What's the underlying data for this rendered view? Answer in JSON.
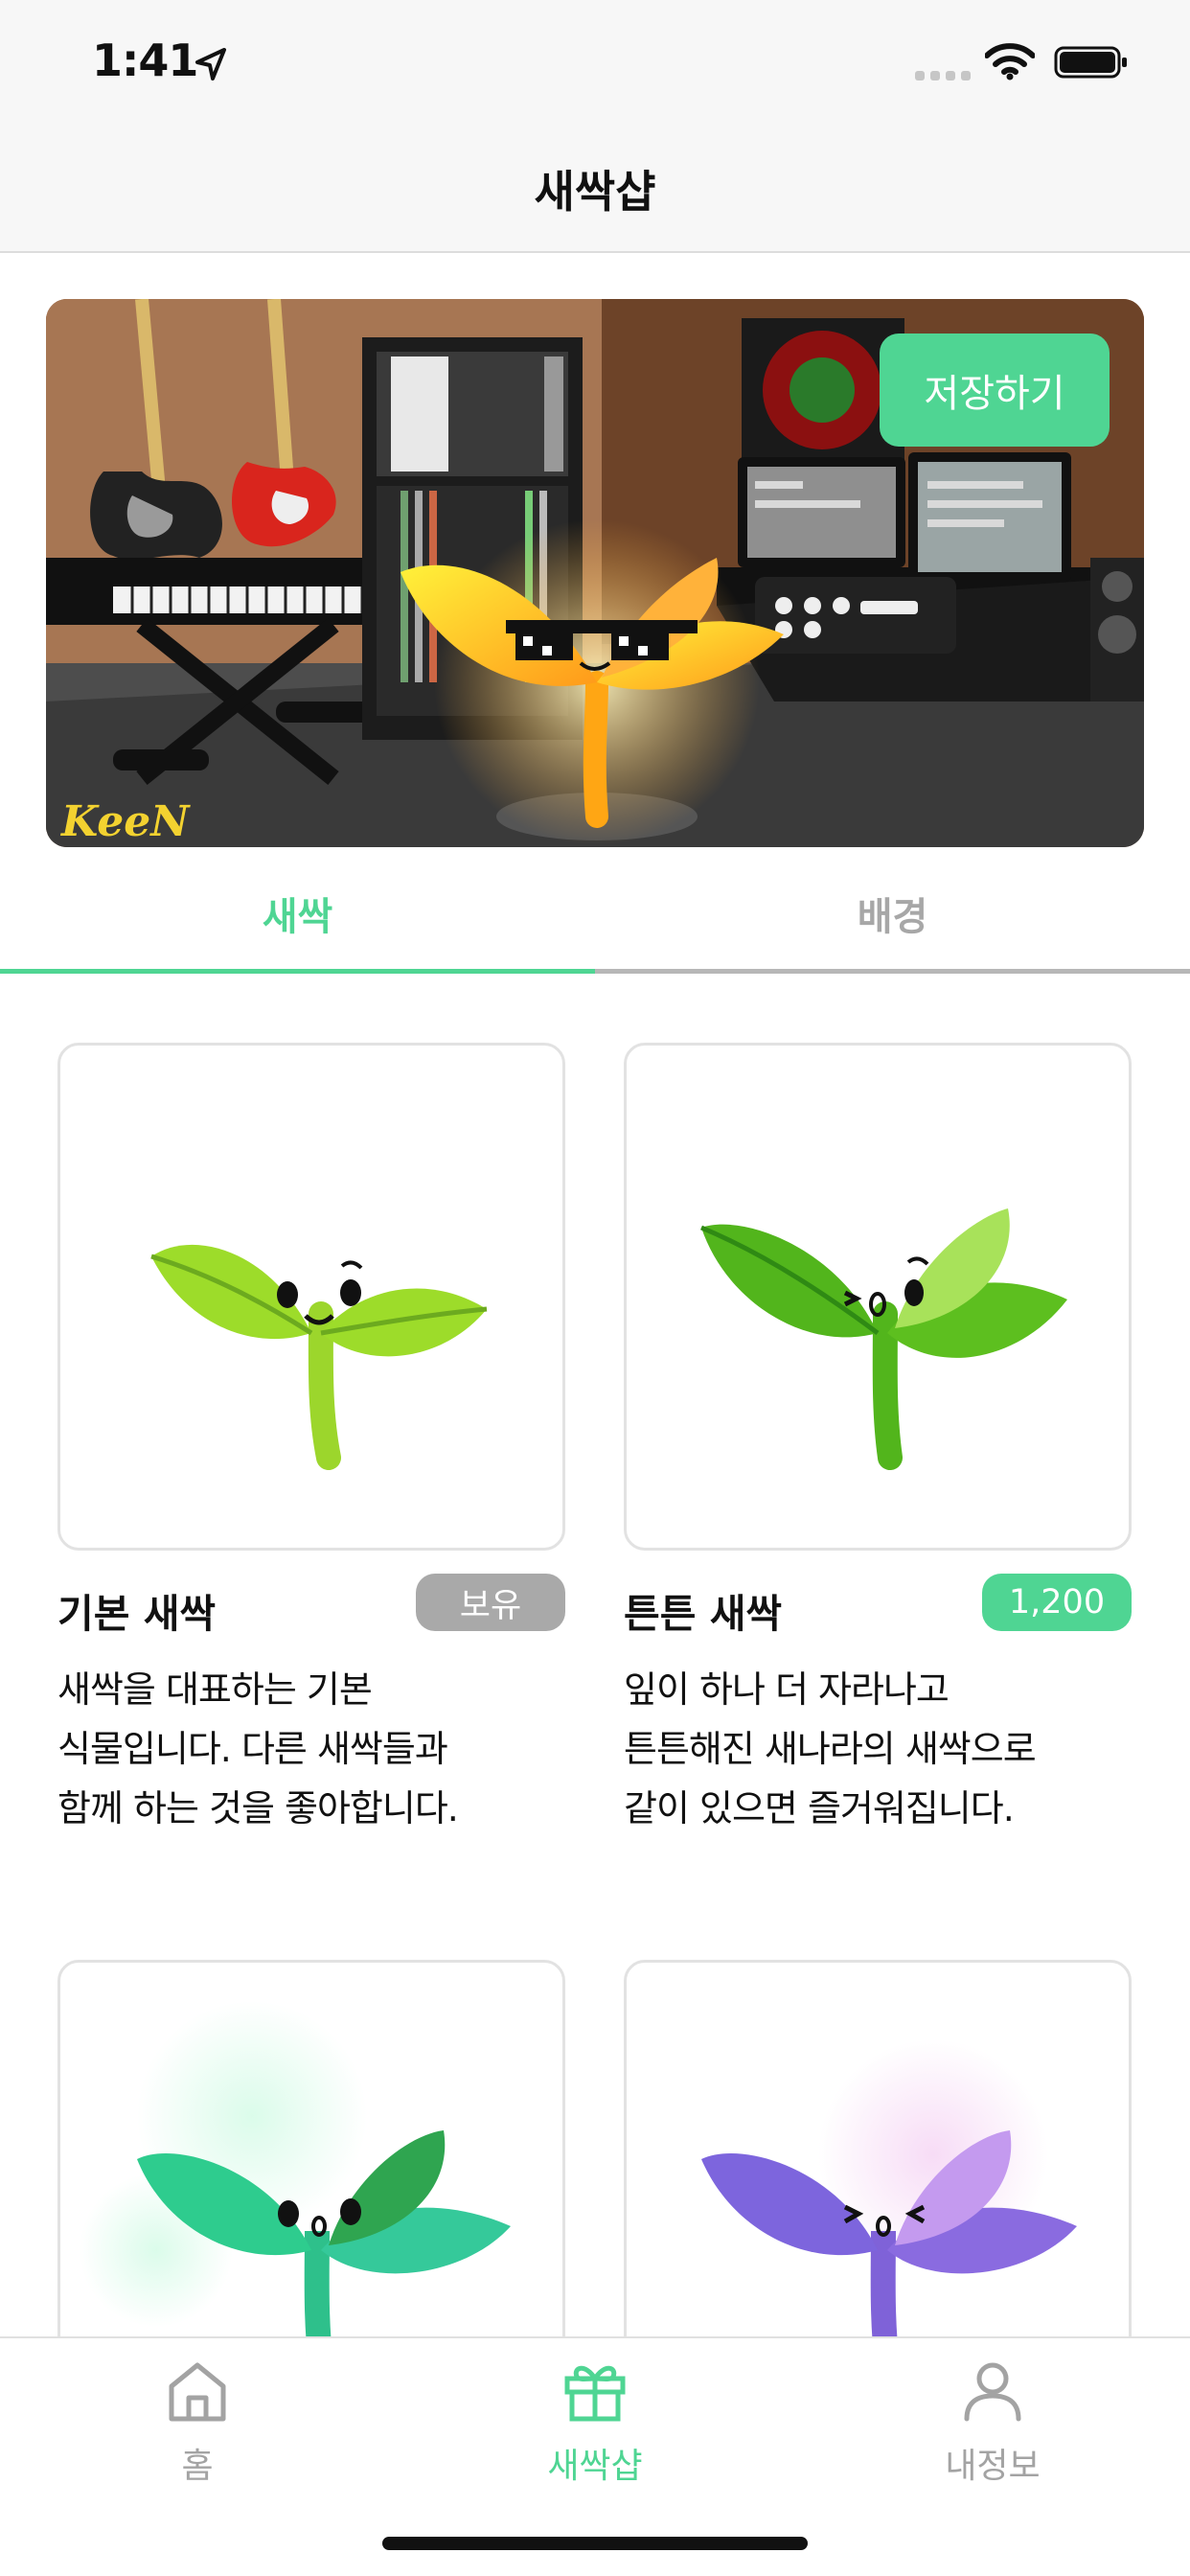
{
  "status_bar": {
    "time": "1:41"
  },
  "nav": {
    "title": "새싹샵"
  },
  "banner": {
    "save_label": "저장하기",
    "signature": "KeeN"
  },
  "tabs": [
    {
      "label": "새싹",
      "active": true
    },
    {
      "label": "배경",
      "active": false
    }
  ],
  "products": [
    {
      "name": "기본 새싹",
      "badge": "보유",
      "description": "새싹을 대표하는 기본\n식물입니다. 다른 새싹들과\n함께 하는 것을 좋아합니다."
    },
    {
      "name": "튼튼 새싹",
      "badge": "1,200",
      "description": "잎이 하나 더 자라나고\n튼튼해진 새나라의 새싹으로\n같이 있으면 즐거워집니다."
    }
  ],
  "tab_bar": {
    "items": [
      {
        "label": "홈",
        "icon": "home-icon",
        "active": false
      },
      {
        "label": "새싹샵",
        "icon": "gift-icon",
        "active": true
      },
      {
        "label": "내정보",
        "icon": "person-icon",
        "active": false
      }
    ]
  },
  "colors": {
    "accent": "#4fd593",
    "owned_badge": "#a9a9a9",
    "inactive": "#a3a3a3"
  }
}
